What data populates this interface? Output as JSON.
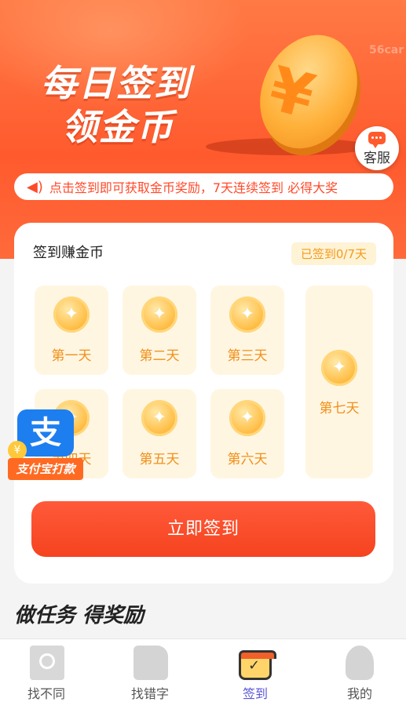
{
  "hero": {
    "title_line1": "每日签到",
    "title_line2": "领金币",
    "watermark": "56car",
    "coin_symbol": "¥"
  },
  "service": {
    "label": "客服",
    "icon": "chat-icon"
  },
  "notice": {
    "icon": "speaker-icon",
    "text": "点击签到即可获取金币奖励，7天连续签到 必得大奖"
  },
  "checkin": {
    "title": "签到赚金币",
    "status": "已签到0/7天",
    "days": [
      {
        "label": "第一天"
      },
      {
        "label": "第二天"
      },
      {
        "label": "第三天"
      },
      {
        "label": "第四天"
      },
      {
        "label": "第五天"
      },
      {
        "label": "第六天"
      },
      {
        "label": "第七天"
      }
    ],
    "button": "立即签到"
  },
  "alipay": {
    "glyph": "支",
    "label": "支付宝打款",
    "coin_glyph": "¥"
  },
  "tasks": {
    "heading": "做任务 得奖励"
  },
  "tabbar": {
    "items": [
      {
        "label": "找不同",
        "icon": "magnifier-icon"
      },
      {
        "label": "找错字",
        "icon": "document-icon"
      },
      {
        "label": "签到",
        "icon": "calendar-check-icon",
        "active": true
      },
      {
        "label": "我的",
        "icon": "profile-icon"
      }
    ]
  },
  "colors": {
    "accent": "#ff5a2e",
    "coin": "#ffc04a",
    "tab_active": "#5b55d6"
  }
}
